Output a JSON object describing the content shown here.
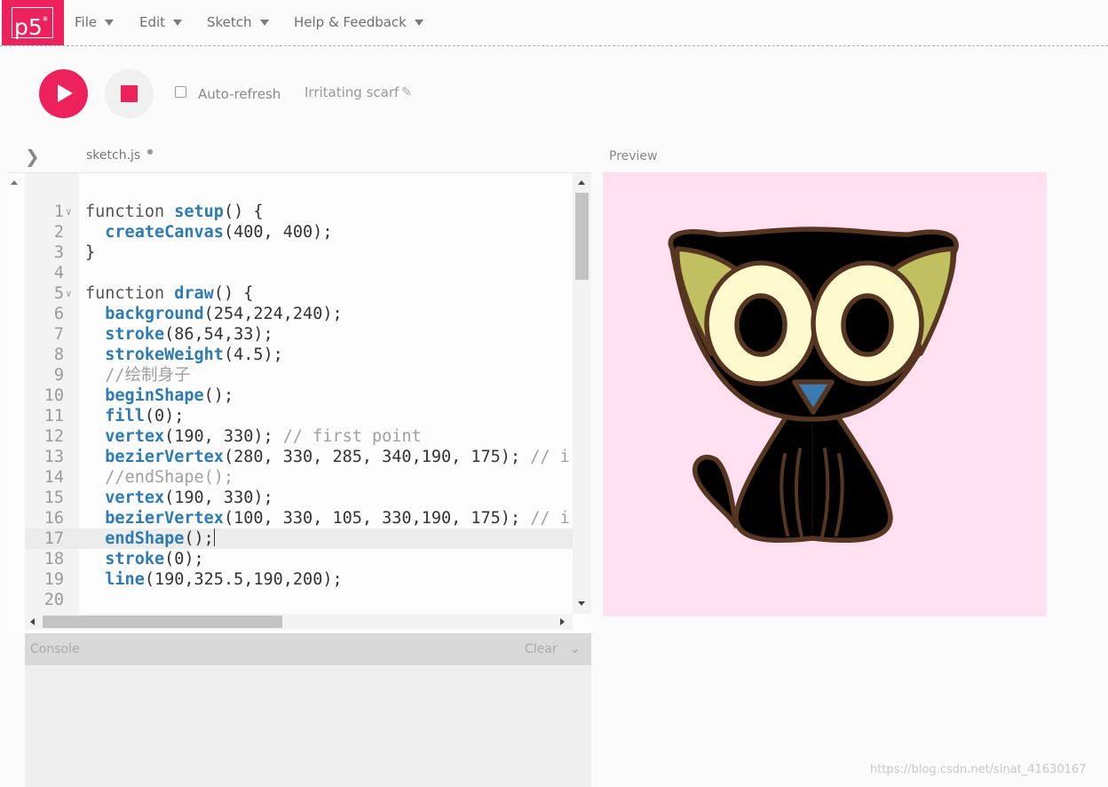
{
  "nav": {
    "logo_text": "p5",
    "logo_sup": "*",
    "menus": [
      "File",
      "Edit",
      "Sketch",
      "Help & Feedback"
    ]
  },
  "toolbar": {
    "auto_refresh_label": "Auto-refresh",
    "auto_refresh_checked": false,
    "project_name": "Irritating scarf"
  },
  "editor": {
    "filename": "sketch.js",
    "active_line": 17,
    "lines": [
      {
        "n": "1",
        "fold": true
      },
      {
        "n": "2"
      },
      {
        "n": "3"
      },
      {
        "n": "4"
      },
      {
        "n": "5",
        "fold": true
      },
      {
        "n": "6"
      },
      {
        "n": "7"
      },
      {
        "n": "8"
      },
      {
        "n": "9"
      },
      {
        "n": "10"
      },
      {
        "n": "11"
      },
      {
        "n": "12"
      },
      {
        "n": "13"
      },
      {
        "n": "14"
      },
      {
        "n": "15"
      },
      {
        "n": "16"
      },
      {
        "n": "17"
      },
      {
        "n": "18"
      },
      {
        "n": "19"
      },
      {
        "n": "20"
      }
    ],
    "code": {
      "l1a": "function ",
      "l1b": "setup",
      "l1c": "() {",
      "l2a": "  ",
      "l2b": "createCanvas",
      "l2c": "(400, 400);",
      "l3": "}",
      "l5a": "function ",
      "l5b": "draw",
      "l5c": "() {",
      "l6a": "  ",
      "l6b": "background",
      "l6c": "(254,224,240);",
      "l7a": "  ",
      "l7b": "stroke",
      "l7c": "(86,54,33);",
      "l8a": "  ",
      "l8b": "strokeWeight",
      "l8c": "(4.5);",
      "l9": "  //绘制身子",
      "l10a": "  ",
      "l10b": "beginShape",
      "l10c": "();",
      "l11a": "  ",
      "l11b": "fill",
      "l11c": "(0);",
      "l12a": "  ",
      "l12b": "vertex",
      "l12c": "(190, 330); ",
      "l12d": "// first point",
      "l13a": "  ",
      "l13b": "bezierVertex",
      "l13c": "(280, 330, 285, 340,190, 175); ",
      "l13d": "// i",
      "l14": "  //endShape();",
      "l15a": "  ",
      "l15b": "vertex",
      "l15c": "(190, 330);",
      "l16a": "  ",
      "l16b": "bezierVertex",
      "l16c": "(100, 330, 105, 330,190, 175); ",
      "l16d": "// i",
      "l17a": "  ",
      "l17b": "endShape",
      "l17c": "();",
      "l18a": "  ",
      "l18b": "stroke",
      "l18c": "(0);",
      "l19a": "  ",
      "l19b": "line",
      "l19c": "(190,325.5,190,200);"
    }
  },
  "console": {
    "title": "Console",
    "clear_label": "Clear"
  },
  "preview": {
    "label": "Preview",
    "background": "#fee0f0",
    "stroke": "#563621",
    "ear_inner": "#c0c060",
    "eye_white": "#fffacd",
    "nose": "#3a7bb0"
  },
  "watermark": "https://blog.csdn.net/sinat_41630167",
  "colors": {
    "accent": "#ed225d",
    "keyword_fn": "#2d7bb6",
    "comment": "#a0a0a0"
  }
}
